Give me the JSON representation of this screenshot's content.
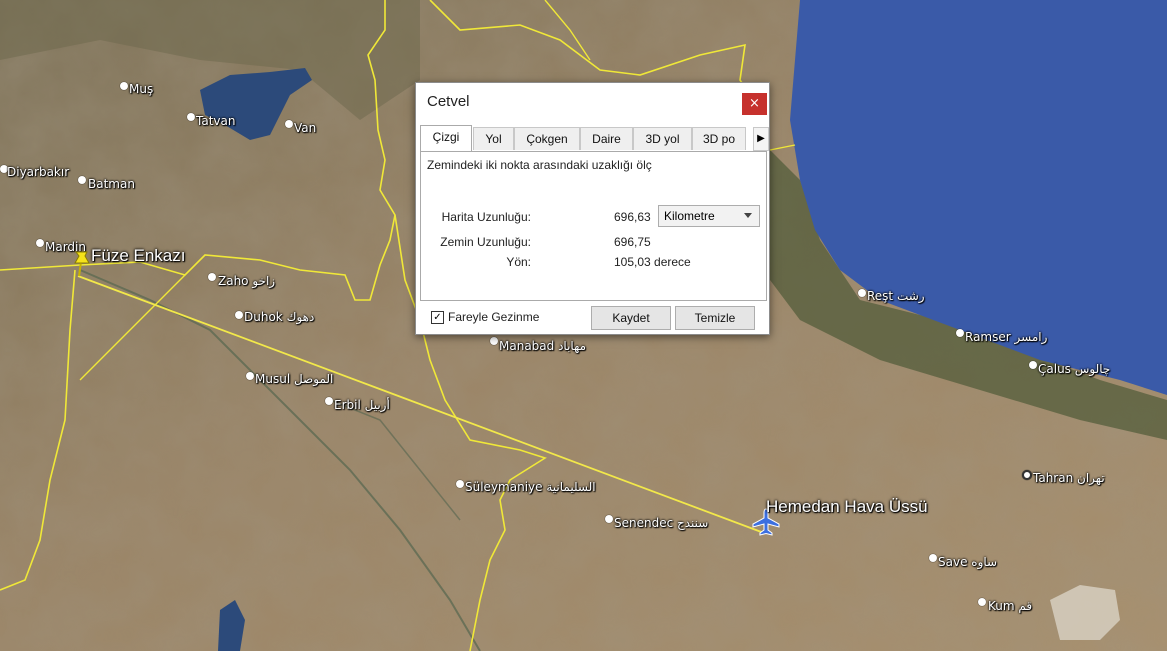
{
  "map": {
    "colors": {
      "water": "#3a5aa8",
      "border": "#f0e838",
      "ruler": "#f2e84a",
      "land": "#9a8466"
    },
    "places": [
      {
        "name": "Muş",
        "icon": "place-dot"
      },
      {
        "name": "Tatvan",
        "icon": "place-dot"
      },
      {
        "name": "Van",
        "icon": "place-dot"
      },
      {
        "name": "Diyarbakır",
        "icon": "place-dot"
      },
      {
        "name": "Batman",
        "icon": "place-dot"
      },
      {
        "name": "Mardin",
        "icon": "place-dot"
      },
      {
        "name": "Zaho زاخو",
        "icon": "place-dot"
      },
      {
        "name": "Duhok دهوك",
        "icon": "place-dot"
      },
      {
        "name": "Musul الموصل",
        "icon": "place-dot"
      },
      {
        "name": "Erbil أربيل",
        "icon": "place-dot"
      },
      {
        "name": "Manabad مهاباد",
        "icon": "place-dot"
      },
      {
        "name": "Süleymaniye السليمانية",
        "icon": "place-dot"
      },
      {
        "name": "Senendec سنندج",
        "icon": "place-dot"
      },
      {
        "name": "Reşt رشت",
        "icon": "place-dot"
      },
      {
        "name": "Ramser رامسر",
        "icon": "place-dot"
      },
      {
        "name": "Çalus چالوس",
        "icon": "place-dot"
      },
      {
        "name": "Tahran تهران",
        "icon": "capital-dot"
      },
      {
        "name": "Save ساوه",
        "icon": "place-dot"
      },
      {
        "name": "Kum قم",
        "icon": "place-dot"
      }
    ],
    "placemarks": [
      {
        "name": "Füze Enkazı",
        "icon": "pushpin-icon"
      },
      {
        "name": "Hemedan Hava Üssü",
        "icon": "airplane-icon"
      }
    ]
  },
  "dialog": {
    "title": "Cetvel",
    "close_label": "×",
    "tabs": [
      "Çizgi",
      "Yol",
      "Çokgen",
      "Daire",
      "3D yol",
      "3D po"
    ],
    "active_tab": "Çizgi",
    "description": "Zemindeki iki nokta arasındaki uzaklığı ölç",
    "rows": [
      {
        "label": "Harita Uzunluğu:",
        "value": "696,63"
      },
      {
        "label": "Zemin Uzunluğu:",
        "value": "696,75"
      },
      {
        "label": "Yön:",
        "value": "105,03 derece"
      }
    ],
    "unit": "Kilometre",
    "mouse_nav_label": "Fareyle Gezinme",
    "mouse_nav_checked": "✓",
    "save_label": "Kaydet",
    "clear_label": "Temizle"
  }
}
